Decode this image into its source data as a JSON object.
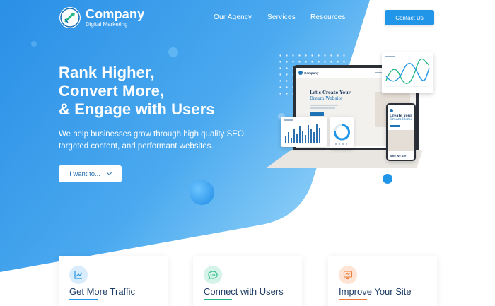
{
  "brand": {
    "name": "Company",
    "tagline": "Digital Marketing",
    "colors": {
      "primary": "#2196e8",
      "hero_start": "#2a8fe6",
      "hero_end": "#76c3f5",
      "text_dark": "#1f3d66"
    }
  },
  "nav": {
    "items": [
      {
        "label": "Our Agency"
      },
      {
        "label": "Services"
      },
      {
        "label": "Resources"
      }
    ],
    "cta_label": "Contact Us"
  },
  "hero": {
    "headline_lines": [
      "Rank Higher,",
      "Convert More,",
      "& Engage with Users"
    ],
    "subtext": "We help businesses grow through high quality SEO, targeted content, and performant websites.",
    "dropdown_label": "I want to..."
  },
  "mockup": {
    "site_name": "Company",
    "site_headline_1": "Let's Create Your",
    "site_headline_2": "Dream Website",
    "phone_headline_1": "Create Your",
    "phone_headline_2": "Dream Home",
    "phone_footer": "Who We Are"
  },
  "features": [
    {
      "title": "Get More Traffic",
      "icon": "chart-icon",
      "accent": "#2196e8",
      "icon_bg": "#d8ecfb"
    },
    {
      "title": "Connect with Users",
      "icon": "chat-icon",
      "accent": "#22b883",
      "icon_bg": "#d5f3e8"
    },
    {
      "title": "Improve Your Site",
      "icon": "monitor-icon",
      "accent": "#f07d3c",
      "icon_bg": "#fde4d5"
    }
  ]
}
